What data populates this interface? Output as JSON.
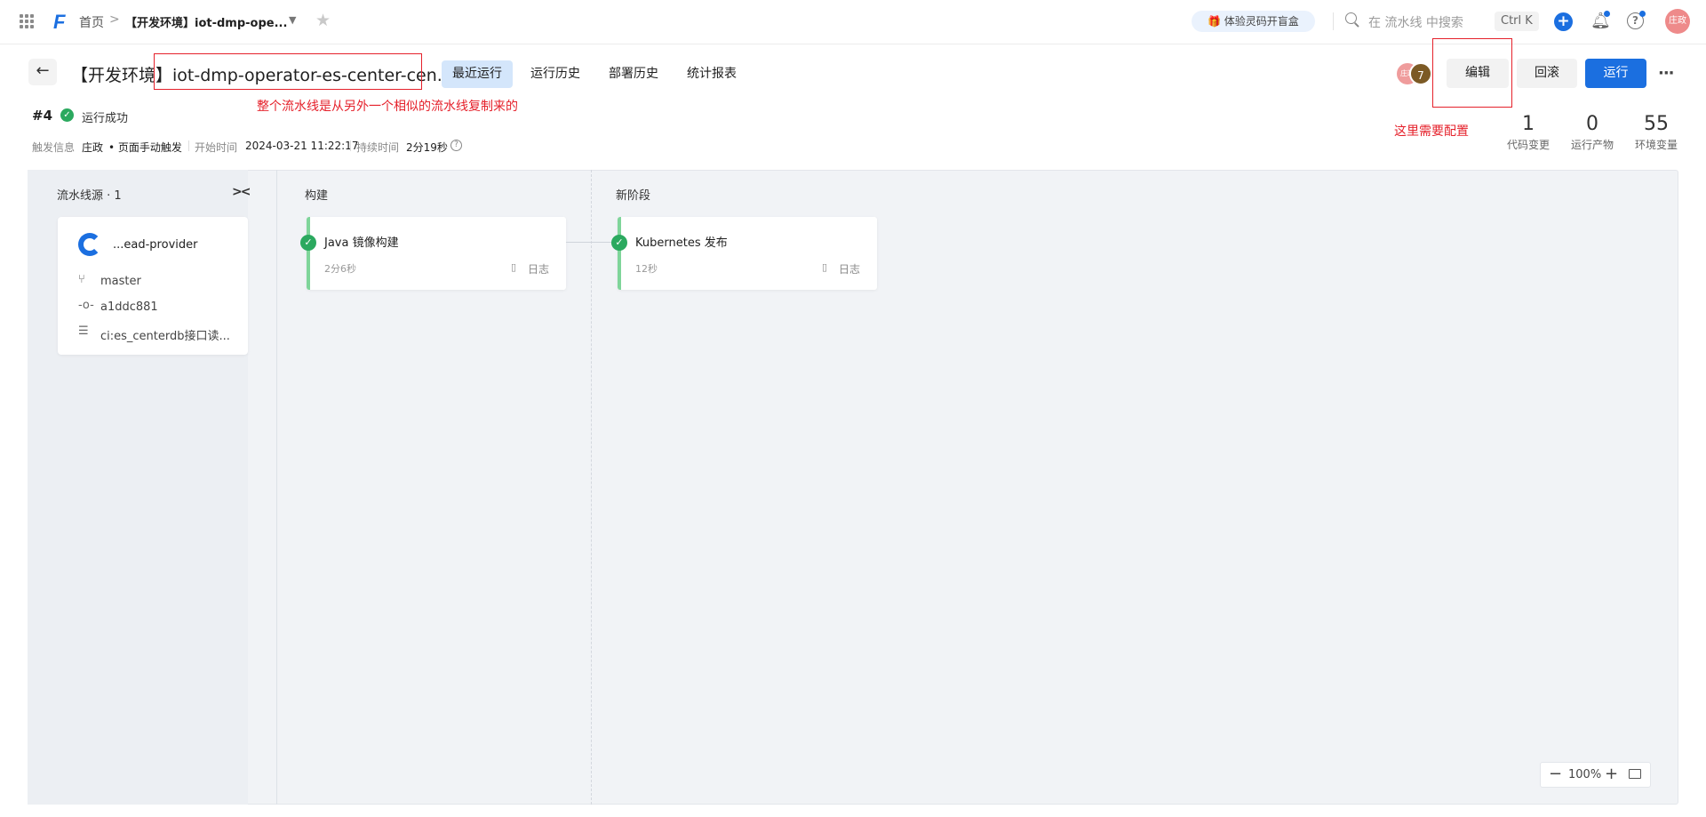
{
  "topbar": {
    "logo": "F",
    "breadcrumb_home": "首页",
    "breadcrumb_sep": ">",
    "breadcrumb_current": "【开发环境】iot-dmp-ope...",
    "promo": "🎁 体验灵码开盲盒",
    "search_placeholder": "在 流水线 中搜索",
    "shortcut": "Ctrl K",
    "user_avatar": "庄政"
  },
  "header": {
    "title": "【开发环境】iot-dmp-operator-es-center-cen...",
    "tabs": [
      {
        "label": "最近运行",
        "active": true
      },
      {
        "label": "运行历史",
        "active": false
      },
      {
        "label": "部署历史",
        "active": false
      },
      {
        "label": "统计报表",
        "active": false
      }
    ],
    "annotation_title": "整个流水线是从另外一个相似的流水线复制来的",
    "annotation_edit": "这里需要配置",
    "collaborator_avatar": "庄政",
    "collaborator_count": "7",
    "buttons": {
      "edit": "编辑",
      "rollback": "回滚",
      "run": "运行"
    },
    "stats": [
      {
        "value": "1",
        "label": "代码变更"
      },
      {
        "value": "0",
        "label": "运行产物"
      },
      {
        "value": "55",
        "label": "环境变量"
      }
    ]
  },
  "run": {
    "number": "#4",
    "status": "运行成功",
    "trigger_label": "触发信息",
    "trigger_user": "庄政",
    "trigger_mode": "• 页面手动触发",
    "start_label": "开始时间",
    "start_time": "2024-03-21 11:22:17",
    "duration_label": "持续时间",
    "duration": "2分19秒"
  },
  "pipeline": {
    "source_title": "流水线源 · 1",
    "source": {
      "name": "...ead-provider",
      "branch": "master",
      "commit": "a1ddc881",
      "message": "ci:es_centerdb接口读..."
    },
    "stages": [
      {
        "title": "构建",
        "job": "Java 镜像构建",
        "duration": "2分6秒",
        "log": "日志",
        "status": "success"
      },
      {
        "title": "新阶段",
        "job": "Kubernetes 发布",
        "duration": "12秒",
        "log": "日志",
        "status": "success"
      }
    ],
    "zoom": "100%"
  },
  "colors": {
    "accent": "#1b6fe0",
    "success": "#2ba95f",
    "annotation": "#e5212b"
  }
}
